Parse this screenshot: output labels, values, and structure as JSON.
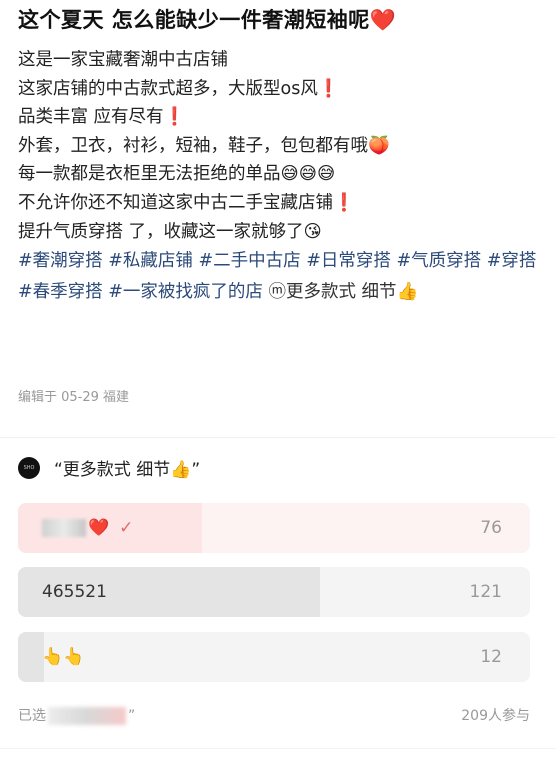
{
  "post": {
    "title": "这个夏天 怎么能缺少一件奢潮短袖呢❤️",
    "lines": [
      "这是一家宝藏奢潮中古店铺",
      "这家店铺的中古款式超多，大版型os风❗",
      "品类丰富 应有尽有❗",
      "外套，卫衣，衬衫，短袖，鞋子，包包都有哦🍑",
      "每一款都是衣柜里无法拒绝的单品😅😅😅",
      "不允许你还不知道这家中古二手宝藏店铺❗",
      "提升气质穿搭 了，收藏这一家就够了😘"
    ],
    "tags": [
      "#奢潮穿搭",
      "#私藏店铺",
      "#二手中古店",
      "#日常穿搭",
      "#气质穿搭",
      "#穿搭",
      "#春季穿搭",
      "#一家被找疯了的店"
    ],
    "tail_icon": "ⓜ",
    "tail_text": "更多款式 细节👍",
    "meta": "编辑于 05-29 福建"
  },
  "poll": {
    "title": "“更多款式 细节👍”",
    "avatar_text": "SHO",
    "options": [
      {
        "label": "❤️",
        "label_blurred": true,
        "selected": true,
        "count": "76",
        "fill_fraction": 0.36,
        "fill_color": "#fde5e5",
        "bg_color": "#fdf3f3"
      },
      {
        "label": "465521",
        "label_blurred": false,
        "selected": false,
        "count": "121",
        "fill_fraction": 0.59,
        "fill_color": "#e4e4e4",
        "bg_color": "#f4f4f4"
      },
      {
        "label": "👆👆",
        "label_blurred": false,
        "selected": false,
        "count": "12",
        "fill_fraction": 0.05,
        "fill_color": "#e4e4e4",
        "bg_color": "#f4f4f4"
      }
    ],
    "check_icon": "✓",
    "footer_prefix": "已选",
    "footer_suffix": "”",
    "participants": "209人参与"
  }
}
